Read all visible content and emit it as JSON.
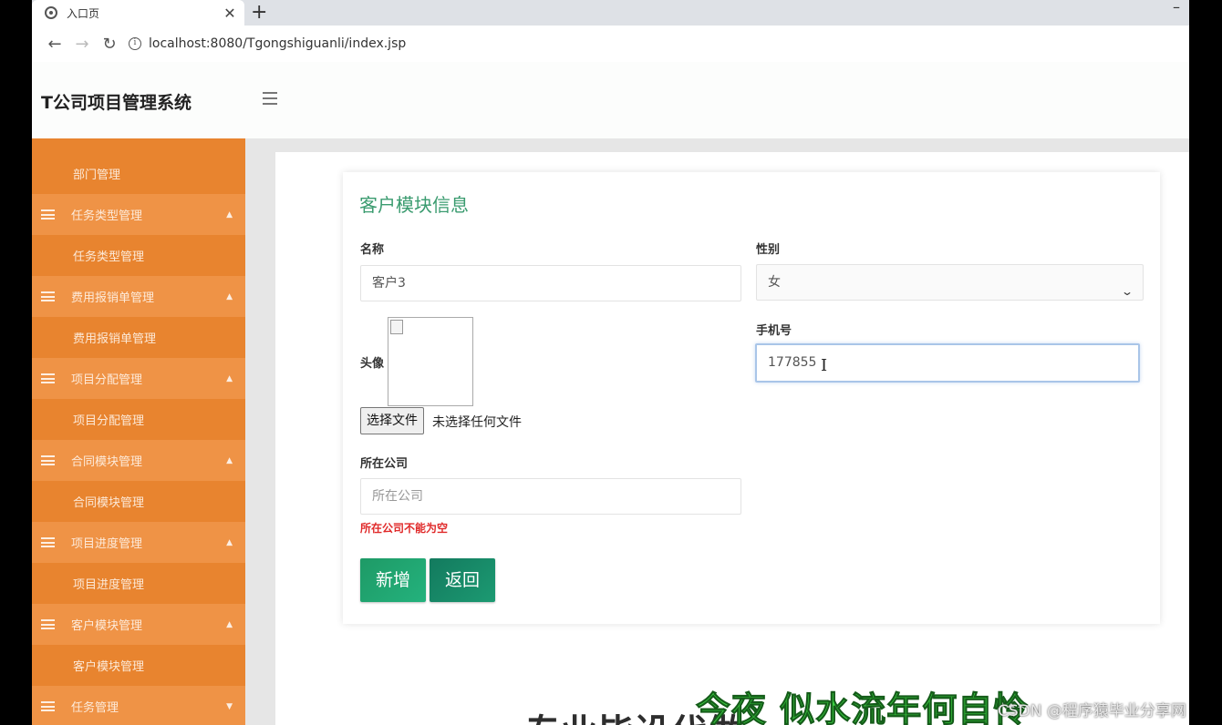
{
  "browser": {
    "tab_title": "入口页",
    "tab_close": "✕",
    "new_tab": "+",
    "minimize": "–",
    "url": "localhost:8080/Tgongshiguanli/index.jsp",
    "back": "←",
    "forward": "→",
    "reload": "↻",
    "info": "i"
  },
  "app": {
    "title": "T公司项目管理系统"
  },
  "sidebar": {
    "items": [
      {
        "label": "部门管理",
        "kind": "child"
      },
      {
        "label": "任务类型管理",
        "kind": "parent",
        "arrow": "▲"
      },
      {
        "label": "任务类型管理",
        "kind": "child"
      },
      {
        "label": "费用报销单管理",
        "kind": "parent",
        "arrow": "▲"
      },
      {
        "label": "费用报销单管理",
        "kind": "child"
      },
      {
        "label": "项目分配管理",
        "kind": "parent",
        "arrow": "▲"
      },
      {
        "label": "项目分配管理",
        "kind": "child"
      },
      {
        "label": "合同模块管理",
        "kind": "parent",
        "arrow": "▲"
      },
      {
        "label": "合同模块管理",
        "kind": "child"
      },
      {
        "label": "项目进度管理",
        "kind": "parent",
        "arrow": "▲"
      },
      {
        "label": "项目进度管理",
        "kind": "child"
      },
      {
        "label": "客户模块管理",
        "kind": "parent",
        "arrow": "▲"
      },
      {
        "label": "客户模块管理",
        "kind": "child"
      },
      {
        "label": "任务管理",
        "kind": "parent",
        "arrow": "▼"
      }
    ]
  },
  "form": {
    "title": "客户模块信息",
    "name_label": "名称",
    "name_value": "客户3",
    "gender_label": "性别",
    "gender_value": "女",
    "gender_arrow": "⌄",
    "avatar_label": "头像",
    "file_button": "选择文件",
    "file_status": "未选择任何文件",
    "phone_label": "手机号",
    "phone_value": "177855",
    "company_label": "所在公司",
    "company_placeholder": "所在公司",
    "company_error": "所在公司不能为空",
    "add_button": "新增",
    "back_button": "返回",
    "cursor": "I"
  },
  "overlay": {
    "bg_heading": "专业毕设代做",
    "subtitle": "今夜 似水流年何自怜",
    "watermark": "CSDN @程序猿毕业分享网"
  },
  "colors": {
    "sidebar": "#ec8a3a",
    "accent_green": "#1e9a66",
    "title_green": "#3a9b6f",
    "error_red": "#e02a2a"
  }
}
